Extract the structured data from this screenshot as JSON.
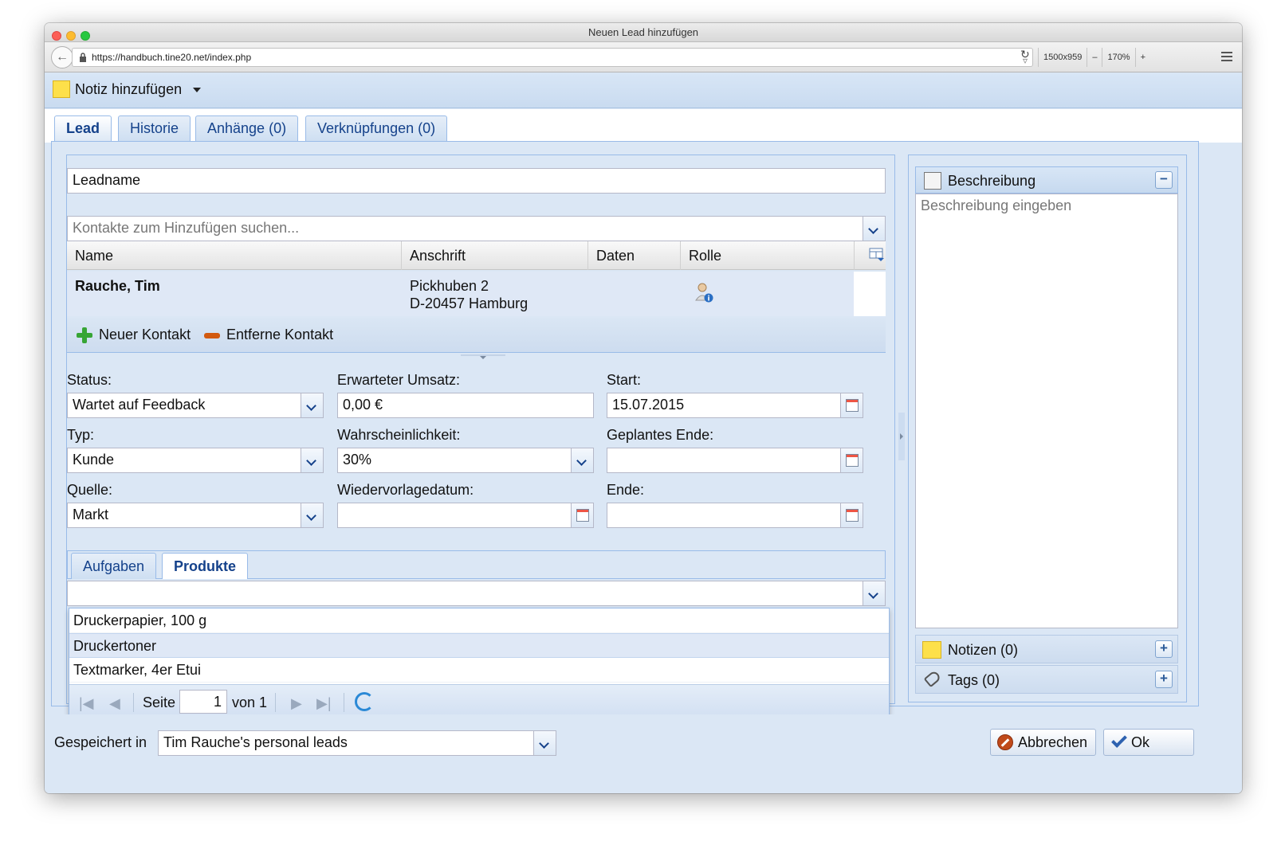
{
  "window": {
    "title": "Neuen Lead hinzufügen"
  },
  "browser": {
    "url": "https://handbuch.tine20.net/index.php",
    "viewport_size": "1500x959",
    "zoom": "170%",
    "zoom_minus": "–",
    "zoom_plus": "+"
  },
  "toolbar": {
    "add_note_label": "Notiz hinzufügen"
  },
  "tabs": [
    {
      "label": "Lead",
      "active": true
    },
    {
      "label": "Historie"
    },
    {
      "label": "Anhänge (0)"
    },
    {
      "label": "Verknüpfungen (0)"
    }
  ],
  "lead": {
    "leadname_value": "Leadname",
    "contact_search_placeholder": "Kontakte zum Hinzufügen suchen...",
    "grid_columns": [
      "Name",
      "Anschrift",
      "Daten",
      "Rolle"
    ],
    "contacts": [
      {
        "name": "Rauche, Tim",
        "address_line1": "Pickhuben 2",
        "address_line2": "D-20457 Hamburg",
        "data": ""
      }
    ],
    "new_contact_label": "Neuer Kontakt",
    "remove_contact_label": "Entferne Kontakt"
  },
  "form": {
    "status_label": "Status:",
    "status_value": "Wartet auf Feedback",
    "revenue_label": "Erwarteter Umsatz:",
    "revenue_value": "0,00 €",
    "start_label": "Start:",
    "start_value": "15.07.2015",
    "type_label": "Typ:",
    "type_value": "Kunde",
    "probability_label": "Wahrscheinlichkeit:",
    "probability_value": "30%",
    "planned_end_label": "Geplantes Ende:",
    "planned_end_value": "",
    "source_label": "Quelle:",
    "source_value": "Markt",
    "resubmission_label": "Wiedervorlagedatum:",
    "resubmission_value": "",
    "end_label": "Ende:",
    "end_value": ""
  },
  "subtabs": [
    {
      "label": "Aufgaben"
    },
    {
      "label": "Produkte",
      "active": true
    }
  ],
  "products": {
    "combo_value": "",
    "items": [
      "Druckerpapier, 100 g",
      "Druckertoner",
      "Textmarker, 4er Etui"
    ],
    "hovered_index": 1,
    "pager": {
      "page_label": "Seite",
      "page_value": "1",
      "of_label": "von 1"
    }
  },
  "sidebar": {
    "description_title": "Beschreibung",
    "description_placeholder": "Beschreibung eingeben",
    "collapse_label": "−",
    "notes_label": "Notizen (0)",
    "tags_label": "Tags (0)",
    "expand_label": "+"
  },
  "footer": {
    "saved_in_label": "Gespeichert in",
    "saved_in_value": "Tim Rauche's personal leads",
    "cancel_label": "Abbrechen",
    "ok_label": "Ok"
  },
  "colors": {
    "accent": "#15428b",
    "panel": "#dbe7f5",
    "border": "#99bbe8"
  }
}
